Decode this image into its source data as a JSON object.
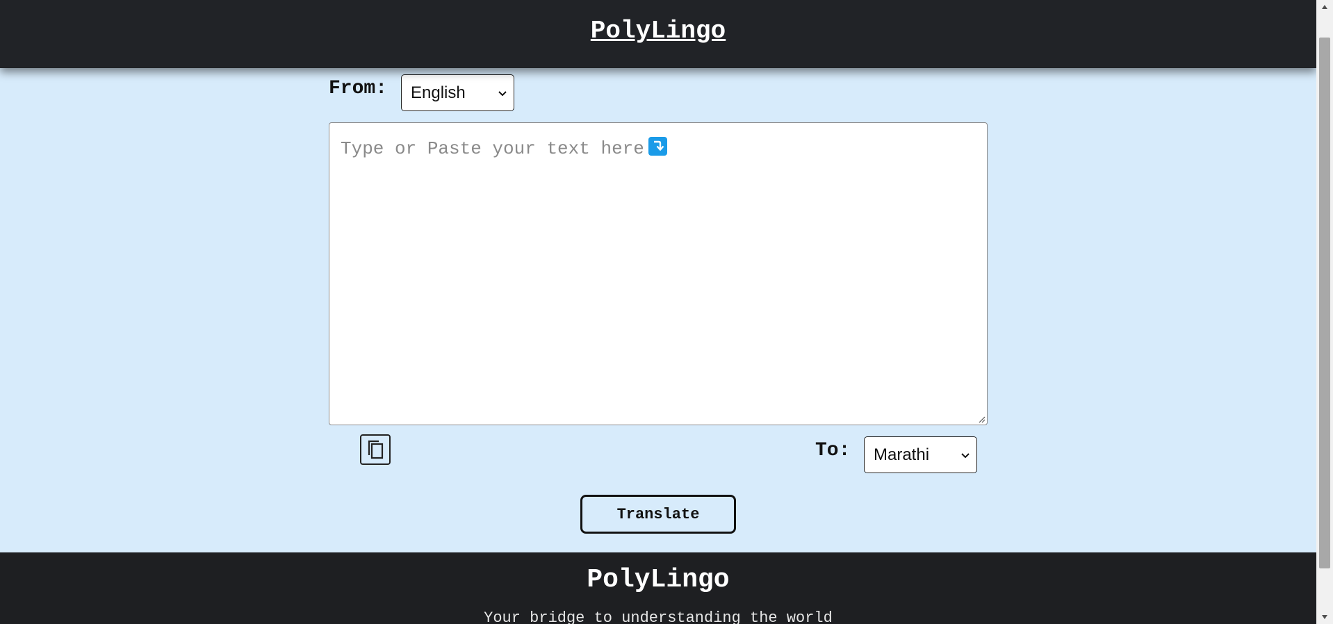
{
  "header": {
    "brand": "PolyLingo"
  },
  "source": {
    "label": "From:",
    "selected_language": "English",
    "placeholder": "Type or Paste your text here"
  },
  "target": {
    "label": "To:",
    "selected_language": "Marathi"
  },
  "actions": {
    "translate_label": "Translate",
    "copy_icon": "copy-icon"
  },
  "footer": {
    "brand": "PolyLingo",
    "tagline": "Your bridge to understanding the world"
  },
  "colors": {
    "page_background": "#d7ebfb",
    "header_background": "#212327",
    "footer_background": "#1e1f22",
    "accent_badge": "#1a9be8"
  }
}
